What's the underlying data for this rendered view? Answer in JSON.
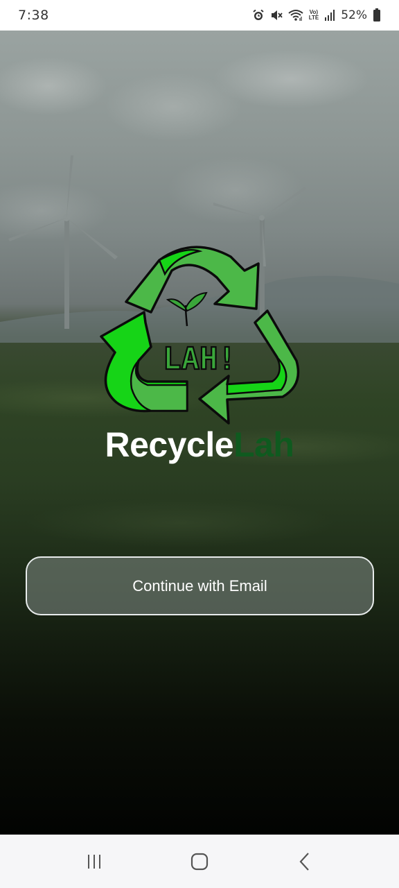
{
  "status_bar": {
    "time": "7:38",
    "lte_top": "Vo)",
    "lte_bottom": "LTE",
    "battery": "52%",
    "icons": [
      "alarm-icon",
      "mute-icon",
      "wifi-icon",
      "volte-icon",
      "signal-icon",
      "battery-icon"
    ]
  },
  "logo": {
    "badge_text": "LAH!",
    "colors": {
      "arrow_light": "#4cb848",
      "arrow_bright": "#16d417",
      "outline": "#0b0b0b",
      "leaf": "#3aa63a"
    }
  },
  "app_title": {
    "part1": "Recycle",
    "part2": "Lah",
    "color_part1": "#ffffff",
    "color_part2": "#0f5a1f"
  },
  "actions": {
    "continue_email_label": "Continue with Email"
  },
  "nav_bar": {
    "icons": [
      "recent-apps-icon",
      "home-icon",
      "back-icon"
    ]
  }
}
